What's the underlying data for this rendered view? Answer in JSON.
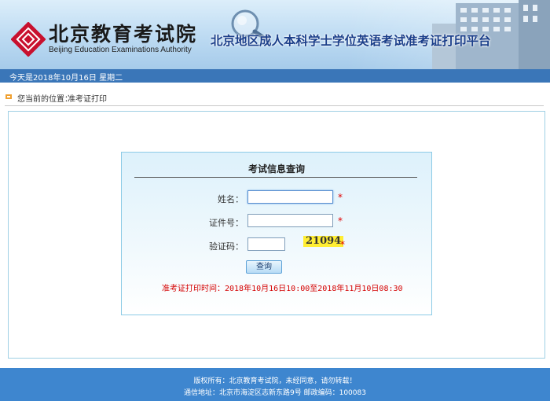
{
  "header": {
    "logo_cn": "北京教育考试院",
    "logo_en": "Beijing Education Examinations Authority",
    "site_title": "北京地区成人本科学士学位英语考试准考证打印平台"
  },
  "datebar": {
    "date_text": "今天是2018年10月16日 星期二"
  },
  "breadcrumb": {
    "label": "您当前的位置：",
    "current": "准考证打印"
  },
  "query_form": {
    "title": "考试信息查询",
    "fields": [
      {
        "label": "姓名：",
        "value": "",
        "required": "*"
      },
      {
        "label": "证件号：",
        "value": "",
        "required": "*"
      },
      {
        "label": "验证码：",
        "value": "",
        "required": "*"
      }
    ],
    "captcha_code": "21094",
    "submit_label": "查询",
    "print_time_label": "准考证打印时间：",
    "print_time_value": "2018年10月16日10:00至2018年11月10日08:30"
  },
  "footer": {
    "copyright": "版权所有：北京教育考试院，未经同意，请勿转载！",
    "address": "通信地址：北京市海淀区志新东路9号 邮政编码：100083"
  },
  "colors": {
    "header_title": "#1b3f8a",
    "datebar_bg": "#3a76b8",
    "footer_bg": "#3e86cf",
    "required_star": "#e00000",
    "print_time_text": "#d40000",
    "captcha_bg": "#ffee33"
  },
  "icons": {
    "logo": "seal-logo-icon",
    "breadcrumb": "location-pin-icon",
    "decoration": "magnifier-icon"
  }
}
